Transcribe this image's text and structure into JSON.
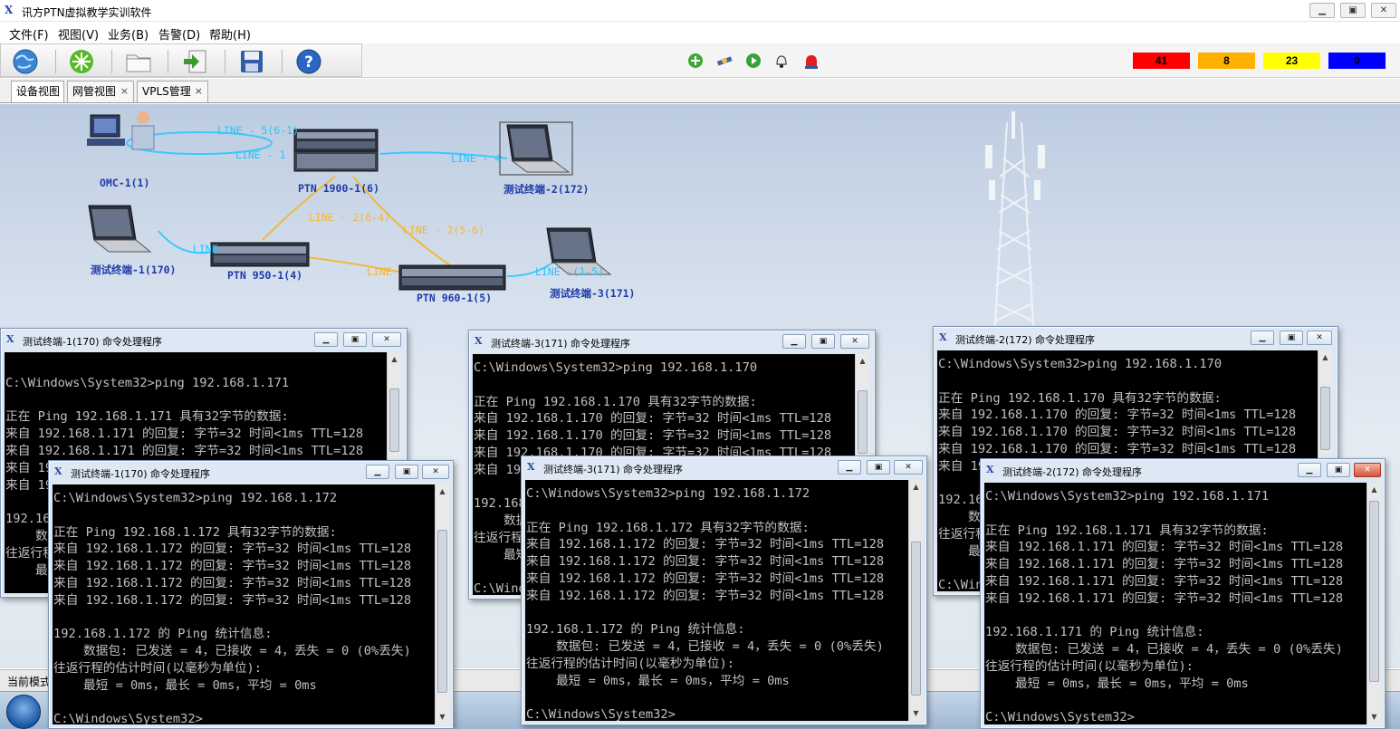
{
  "app": {
    "title": "讯方PTN虚拟教学实训软件",
    "window_buttons": [
      "▁",
      "▣",
      "✕"
    ]
  },
  "menu": [
    "文件(F)",
    "视图(V)",
    "业务(B)",
    "告警(D)",
    "帮助(H)"
  ],
  "toolbar": {
    "left_icons": [
      "globe-icon",
      "network-icon",
      "folder-icon",
      "export-icon",
      "save-icon",
      "help-icon"
    ],
    "control_icons": [
      "add-icon",
      "satellite-icon",
      "play-icon",
      "bell-icon",
      "siren-icon"
    ]
  },
  "alarms": [
    {
      "value": "41",
      "color": "#ff0000"
    },
    {
      "value": "8",
      "color": "#ffb000"
    },
    {
      "value": "23",
      "color": "#ffff00"
    },
    {
      "value": "0",
      "color": "#0000ff"
    }
  ],
  "tabs": [
    {
      "label": "设备视图",
      "closable": false
    },
    {
      "label": "网管视图",
      "closable": true
    },
    {
      "label": "VPLS管理",
      "closable": true
    }
  ],
  "topology": {
    "nodes": {
      "omc": "OMC-1(1)",
      "ptn1900": "PTN 1900-1(6)",
      "term2": "测试终端-2(172)",
      "term1": "测试终端-1(170)",
      "ptn950": "PTN 950-1(4)",
      "ptn960": "PTN 960-1(5)",
      "term3": "测试终端-3(171)"
    },
    "links": {
      "l1": "LINE - 5(6-1)",
      "l2": "LINE - 1",
      "l3": "LINE - 4",
      "l4": "LINE - 2(6-4)",
      "l5": "LINE - 2(5-6)",
      "l6": "LINE",
      "l7": "LINE",
      "l8": "LINE -(1-5)"
    }
  },
  "status": {
    "mode": "当前模式"
  },
  "cmd_windows": [
    {
      "title": "测试终端-1(170) 命令处理程序",
      "lines": [
        "",
        "C:\\Windows\\System32>ping 192.168.1.171",
        "",
        "正在 Ping 192.168.1.171 具有32字节的数据:",
        "来自 192.168.1.171 的回复: 字节=32 时间<1ms TTL=128",
        "来自 192.168.1.171 的回复: 字节=32 时间<1ms TTL=128",
        "来自 192.168.1.171 的回复: 字节=32 时间<1ms TTL=128",
        "来自 192.168.1.171 的回复: 字节=32 时间<1ms TTL=128",
        "",
        "192.168.1.171 的 Ping 统计信息:",
        "    数据包: 已发送 = 4，已接收 = 4，丢失 = 0 (0%丢失)",
        "往返行程的估计时间(以毫秒为单位):",
        "    最短 = 0ms，最长 = 0ms，平均 = 0ms"
      ]
    },
    {
      "title": "测试终端-3(171) 命令处理程序",
      "lines": [
        "C:\\Windows\\System32>ping 192.168.1.170",
        "",
        "正在 Ping 192.168.1.170 具有32字节的数据:",
        "来自 192.168.1.170 的回复: 字节=32 时间<1ms TTL=128",
        "来自 192.168.1.170 的回复: 字节=32 时间<1ms TTL=128",
        "来自 192.168.1.170 的回复: 字节=32 时间<1ms TTL=128",
        "来自 192.168.1.170 的回复: 字节=32 时间<1ms TTL=128",
        "",
        "192.168.1.170 的 Ping 统计信息:",
        "    数据包: 已发送 = 4，已接收 = 4，丢失 = 0 (0%丢失)",
        "往返行程的估计时间(以毫秒为单位):",
        "    最短 = 0ms，最长 = 0ms，平均 = 0ms",
        "",
        "C:\\Windows\\System32>"
      ]
    },
    {
      "title": "测试终端-2(172) 命令处理程序",
      "lines": [
        "C:\\Windows\\System32>ping 192.168.1.170",
        "",
        "正在 Ping 192.168.1.170 具有32字节的数据:",
        "来自 192.168.1.170 的回复: 字节=32 时间<1ms TTL=128",
        "来自 192.168.1.170 的回复: 字节=32 时间<1ms TTL=128",
        "来自 192.168.1.170 的回复: 字节=32 时间<1ms TTL=128",
        "来自 192.168.1.170 的回复: 字节=32 时间<1ms TTL=128",
        "",
        "192.168.1.170 的 Ping 统计信息:",
        "    数据包: 已发送 = 4，已接收 = 4，丢失 = 0 (0%丢失)",
        "往返行程的估计时间(以毫秒为单位):",
        "    最短 = 0ms，最长 = 0ms，平均 = 0ms",
        "",
        "C:\\Windows\\System32>"
      ]
    },
    {
      "title": "测试终端-1(170) 命令处理程序",
      "lines": [
        "C:\\Windows\\System32>ping 192.168.1.172",
        "",
        "正在 Ping 192.168.1.172 具有32字节的数据:",
        "来自 192.168.1.172 的回复: 字节=32 时间<1ms TTL=128",
        "来自 192.168.1.172 的回复: 字节=32 时间<1ms TTL=128",
        "来自 192.168.1.172 的回复: 字节=32 时间<1ms TTL=128",
        "来自 192.168.1.172 的回复: 字节=32 时间<1ms TTL=128",
        "",
        "192.168.1.172 的 Ping 统计信息:",
        "    数据包: 已发送 = 4，已接收 = 4，丢失 = 0 (0%丢失)",
        "往返行程的估计时间(以毫秒为单位):",
        "    最短 = 0ms，最长 = 0ms，平均 = 0ms",
        "",
        "C:\\Windows\\System32>"
      ]
    },
    {
      "title": "测试终端-3(171) 命令处理程序",
      "lines": [
        "C:\\Windows\\System32>ping 192.168.1.172",
        "",
        "正在 Ping 192.168.1.172 具有32字节的数据:",
        "来自 192.168.1.172 的回复: 字节=32 时间<1ms TTL=128",
        "来自 192.168.1.172 的回复: 字节=32 时间<1ms TTL=128",
        "来自 192.168.1.172 的回复: 字节=32 时间<1ms TTL=128",
        "来自 192.168.1.172 的回复: 字节=32 时间<1ms TTL=128",
        "",
        "192.168.1.172 的 Ping 统计信息:",
        "    数据包: 已发送 = 4，已接收 = 4，丢失 = 0 (0%丢失)",
        "往返行程的估计时间(以毫秒为单位):",
        "    最短 = 0ms，最长 = 0ms，平均 = 0ms",
        "",
        "C:\\Windows\\System32>"
      ]
    },
    {
      "title": "测试终端-2(172) 命令处理程序",
      "lines": [
        "C:\\Windows\\System32>ping 192.168.1.171",
        "",
        "正在 Ping 192.168.1.171 具有32字节的数据:",
        "来自 192.168.1.171 的回复: 字节=32 时间<1ms TTL=128",
        "来自 192.168.1.171 的回复: 字节=32 时间<1ms TTL=128",
        "来自 192.168.1.171 的回复: 字节=32 时间<1ms TTL=128",
        "来自 192.168.1.171 的回复: 字节=32 时间<1ms TTL=128",
        "",
        "192.168.1.171 的 Ping 统计信息:",
        "    数据包: 已发送 = 4，已接收 = 4，丢失 = 0 (0%丢失)",
        "往返行程的估计时间(以毫秒为单位):",
        "    最短 = 0ms，最长 = 0ms，平均 = 0ms",
        "",
        "C:\\Windows\\System32>"
      ]
    }
  ]
}
